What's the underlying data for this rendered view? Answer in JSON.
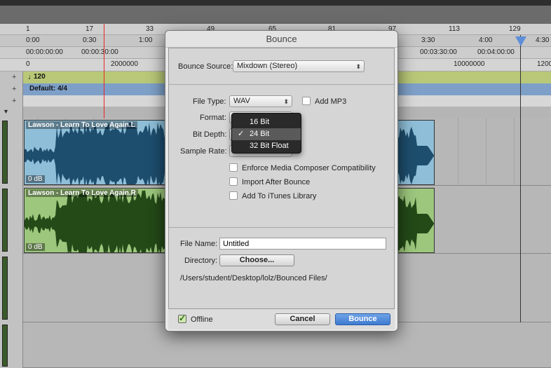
{
  "ruler": {
    "bars": [
      "1",
      "17",
      "33",
      "49",
      "65",
      "81",
      "97",
      "113",
      "129"
    ],
    "minsec": [
      "0:00",
      "0:30",
      "1:00",
      "3:30",
      "4:00",
      "4:30"
    ],
    "timecode": [
      "00:00:00:00",
      "00:00:30:00",
      "00:03:30:00",
      "00:04:00:00"
    ],
    "samples": [
      "0",
      "2000000",
      "10000000",
      "1200"
    ]
  },
  "tempo": "120",
  "meter": "Default: 4/4",
  "tracks": [
    {
      "clip_name": "Lawson - Learn To Love Again.L",
      "gain": "0 dB",
      "color": "#8fbfd8",
      "wave": "#1e4e6e"
    },
    {
      "clip_name": "Lawson - Learn To Love Again.R",
      "gain": "0 dB",
      "color": "#9dc77d",
      "wave": "#244a18"
    }
  ],
  "dialog": {
    "title": "Bounce",
    "bounce_source_label": "Bounce Source:",
    "bounce_source_value": "Mixdown (Stereo)",
    "file_type_label": "File Type:",
    "file_type_value": "WAV",
    "add_mp3_label": "Add MP3",
    "format_label": "Format:",
    "bit_depth_label": "Bit Depth:",
    "sample_rate_label": "Sample Rate:",
    "bit_depth_options": [
      "16 Bit",
      "24 Bit",
      "32 Bit Float"
    ],
    "bit_depth_selected": "24 Bit",
    "checkmark": "✓",
    "enforce_label": "Enforce Media Composer Compatibility",
    "import_after_label": "Import After Bounce",
    "add_itunes_label": "Add To iTunes Library",
    "file_name_label": "File Name:",
    "file_name_value": "Untitled",
    "directory_label": "Directory:",
    "choose_button": "Choose...",
    "directory_path": "/Users/student/Desktop/lolz/Bounced Files/",
    "offline_label": "Offline",
    "offline_checked": true,
    "cancel_button": "Cancel",
    "bounce_button": "Bounce"
  }
}
